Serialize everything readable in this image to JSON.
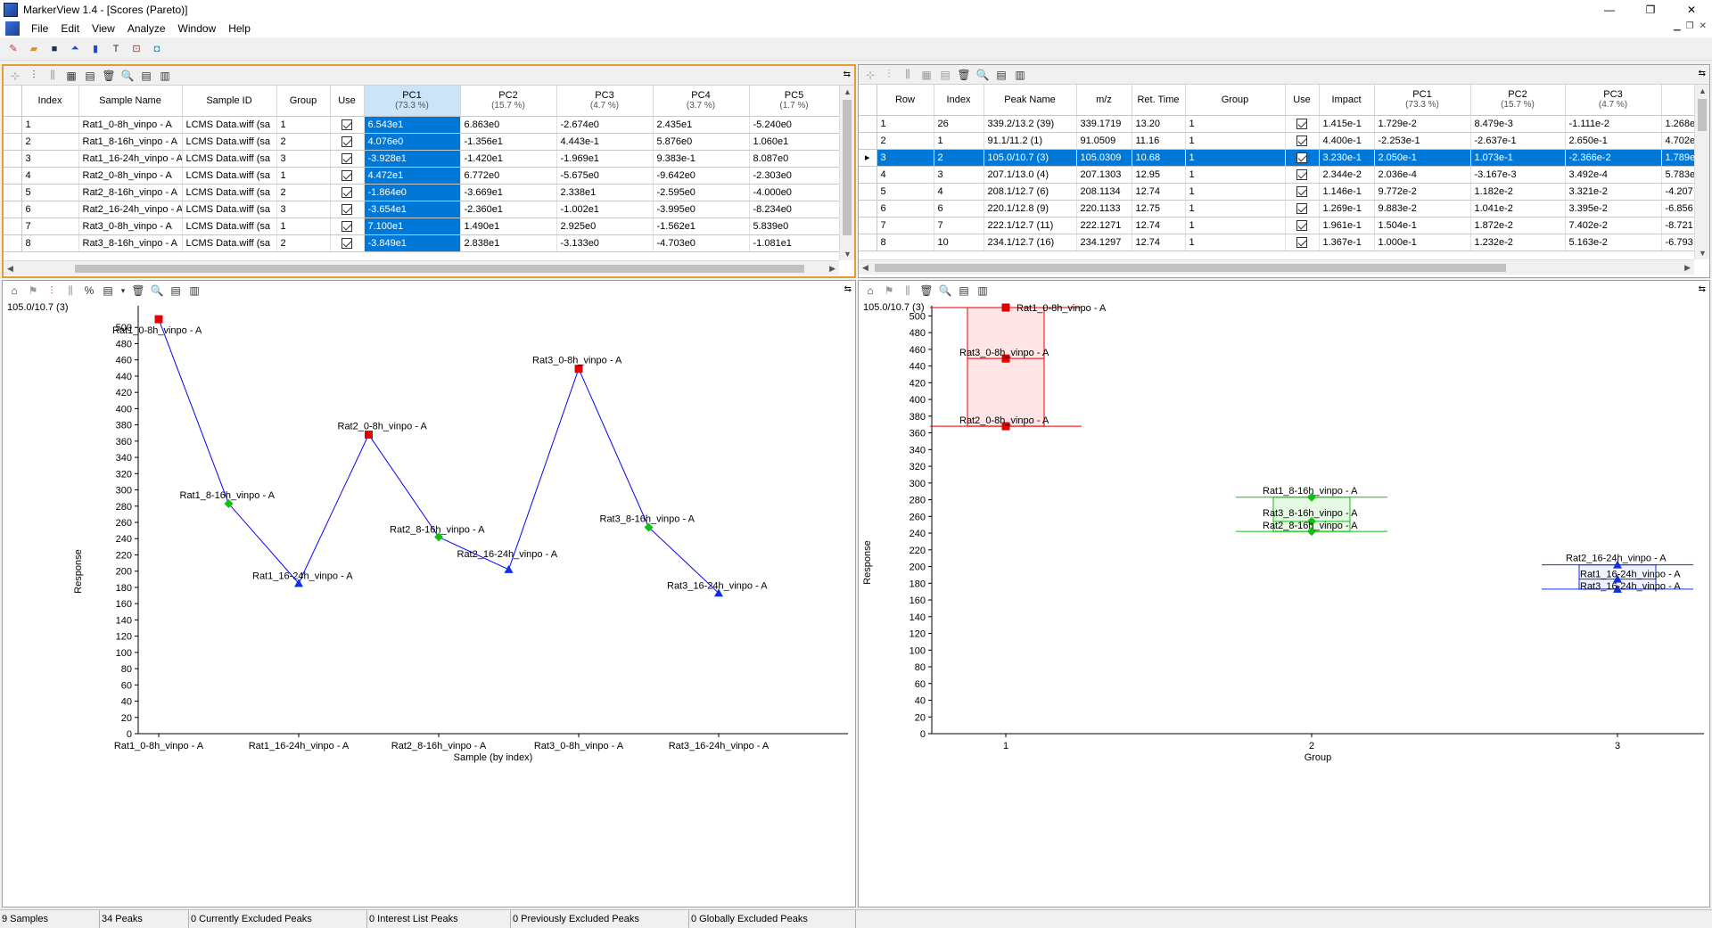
{
  "window": {
    "title": "MarkerView 1.4 - [Scores (Pareto)]",
    "minimize": "—",
    "maximize": "❐",
    "close": "✕"
  },
  "menu": [
    "File",
    "Edit",
    "View",
    "Analyze",
    "Window",
    "Help"
  ],
  "scores_table": {
    "headers": [
      {
        "label": "Index",
        "sub": ""
      },
      {
        "label": "Sample Name",
        "sub": ""
      },
      {
        "label": "Sample ID",
        "sub": ""
      },
      {
        "label": "Group",
        "sub": ""
      },
      {
        "label": "Use",
        "sub": ""
      },
      {
        "label": "PC1",
        "sub": "(73.3 %)"
      },
      {
        "label": "PC2",
        "sub": "(15.7 %)"
      },
      {
        "label": "PC3",
        "sub": "(4.7 %)"
      },
      {
        "label": "PC4",
        "sub": "(3.7 %)"
      },
      {
        "label": "PC5",
        "sub": "(1.7 %)"
      }
    ],
    "rows": [
      [
        "1",
        "Rat1_0-8h_vinpo - A",
        "LCMS Data.wiff (sa",
        "1",
        "6.543e1",
        "6.863e0",
        "-2.674e0",
        "2.435e1",
        "-5.240e0"
      ],
      [
        "2",
        "Rat1_8-16h_vinpo - A",
        "LCMS Data.wiff (sa",
        "2",
        "4.076e0",
        "-1.356e1",
        "4.443e-1",
        "5.876e0",
        "1.060e1"
      ],
      [
        "3",
        "Rat1_16-24h_vinpo - A",
        "LCMS Data.wiff (sa",
        "3",
        "-3.928e1",
        "-1.420e1",
        "-1.969e1",
        "9.383e-1",
        "8.087e0"
      ],
      [
        "4",
        "Rat2_0-8h_vinpo - A",
        "LCMS Data.wiff (sa",
        "1",
        "4.472e1",
        "6.772e0",
        "-5.675e0",
        "-9.642e0",
        "-2.303e0"
      ],
      [
        "5",
        "Rat2_8-16h_vinpo - A",
        "LCMS Data.wiff (sa",
        "2",
        "-1.864e0",
        "-3.669e1",
        "2.338e1",
        "-2.595e0",
        "-4.000e0"
      ],
      [
        "6",
        "Rat2_16-24h_vinpo - A",
        "LCMS Data.wiff (sa",
        "3",
        "-3.654e1",
        "-2.360e1",
        "-1.002e1",
        "-3.995e0",
        "-8.234e0"
      ],
      [
        "7",
        "Rat3_0-8h_vinpo - A",
        "LCMS Data.wiff (sa",
        "1",
        "7.100e1",
        "1.490e1",
        "2.925e0",
        "-1.562e1",
        "5.839e0"
      ],
      [
        "8",
        "Rat3_8-16h_vinpo - A",
        "LCMS Data.wiff (sa",
        "2",
        "-3.849e1",
        "2.838e1",
        "-3.133e0",
        "-4.703e0",
        "-1.081e1"
      ]
    ]
  },
  "peaks_table": {
    "headers": [
      {
        "label": "Row",
        "sub": ""
      },
      {
        "label": "Index",
        "sub": ""
      },
      {
        "label": "Peak Name",
        "sub": ""
      },
      {
        "label": "m/z",
        "sub": ""
      },
      {
        "label": "Ret. Time",
        "sub": ""
      },
      {
        "label": "Group",
        "sub": ""
      },
      {
        "label": "Use",
        "sub": ""
      },
      {
        "label": "Impact",
        "sub": ""
      },
      {
        "label": "PC1",
        "sub": "(73.3 %)"
      },
      {
        "label": "PC2",
        "sub": "(15.7 %)"
      },
      {
        "label": "PC3",
        "sub": "(4.7 %)"
      },
      {
        "label": "",
        "sub": ""
      }
    ],
    "rows": [
      [
        "1",
        "26",
        "339.2/13.2 (39)",
        "339.1719",
        "13.20",
        "1",
        "1.415e-1",
        "1.729e-2",
        "8.479e-3",
        "-1.111e-2",
        "1.268e"
      ],
      [
        "2",
        "1",
        "91.1/11.2 (1)",
        "91.0509",
        "11.16",
        "1",
        "4.400e-1",
        "-2.253e-1",
        "-2.637e-1",
        "2.650e-1",
        "4.702e"
      ],
      [
        "3",
        "2",
        "105.0/10.7 (3)",
        "105.0309",
        "10.68",
        "1",
        "3.230e-1",
        "2.050e-1",
        "1.073e-1",
        "-2.366e-2",
        "1.789e"
      ],
      [
        "4",
        "3",
        "207.1/13.0 (4)",
        "207.1303",
        "12.95",
        "1",
        "2.344e-2",
        "2.036e-4",
        "-3.167e-3",
        "3.492e-4",
        "5.783e"
      ],
      [
        "5",
        "4",
        "208.1/12.7 (6)",
        "208.1134",
        "12.74",
        "1",
        "1.146e-1",
        "9.772e-2",
        "1.182e-2",
        "3.321e-2",
        "-4.207"
      ],
      [
        "6",
        "6",
        "220.1/12.8 (9)",
        "220.1133",
        "12.75",
        "1",
        "1.269e-1",
        "9.883e-2",
        "1.041e-2",
        "3.395e-2",
        "-6.856"
      ],
      [
        "7",
        "7",
        "222.1/12.7 (11)",
        "222.1271",
        "12.74",
        "1",
        "1.961e-1",
        "1.504e-1",
        "1.872e-2",
        "7.402e-2",
        "-8.721"
      ],
      [
        "8",
        "10",
        "234.1/12.7 (16)",
        "234.1297",
        "12.74",
        "1",
        "1.367e-1",
        "1.000e-1",
        "1.232e-2",
        "5.163e-2",
        "-6.793"
      ]
    ],
    "selected_row": 2
  },
  "left_plot": {
    "peak_id": "105.0/10.7 (3)",
    "ylabel": "Response",
    "xlabel": "Sample (by index)",
    "pct_label": "%"
  },
  "right_plot": {
    "peak_id": "105.0/10.7 (3)",
    "ylabel": "Response",
    "xlabel": "Group"
  },
  "chart_data": [
    {
      "type": "line",
      "title": "",
      "xlabel": "Sample (by index)",
      "ylabel": "Response",
      "ylim": [
        0,
        520
      ],
      "yticks": [
        0,
        20,
        40,
        60,
        80,
        100,
        120,
        140,
        160,
        180,
        200,
        220,
        240,
        260,
        280,
        300,
        320,
        340,
        360,
        380,
        400,
        420,
        440,
        460,
        480,
        500
      ],
      "x_tick_labels": [
        "Rat1_0-8h_vinpo - A",
        "Rat1_16-24h_vinpo - A",
        "Rat2_8-16h_vinpo - A",
        "Rat3_0-8h_vinpo - A",
        "Rat3_16-24h_vinpo - A"
      ],
      "x_tick_index": [
        1,
        3,
        5,
        7,
        9
      ],
      "points": [
        {
          "index": 1,
          "label": "Rat1_0-8h_vinpo - A",
          "value": 510,
          "group": 1
        },
        {
          "index": 2,
          "label": "Rat1_8-16h_vinpo - A",
          "value": 283,
          "group": 2
        },
        {
          "index": 3,
          "label": "Rat1_16-24h_vinpo - A",
          "value": 185,
          "group": 3
        },
        {
          "index": 4,
          "label": "Rat2_0-8h_vinpo - A",
          "value": 368,
          "group": 1
        },
        {
          "index": 5,
          "label": "Rat2_8-16h_vinpo - A",
          "value": 242,
          "group": 2
        },
        {
          "index": 6,
          "label": "Rat2_16-24h_vinpo - A",
          "value": 202,
          "group": 3
        },
        {
          "index": 7,
          "label": "Rat3_0-8h_vinpo - A",
          "value": 449,
          "group": 1
        },
        {
          "index": 8,
          "label": "Rat3_8-16h_vinpo - A",
          "value": 254,
          "group": 2
        },
        {
          "index": 9,
          "label": "Rat3_16-24h_vinpo - A",
          "value": 173,
          "group": 3
        }
      ]
    },
    {
      "type": "scatter",
      "title": "",
      "xlabel": "Group",
      "ylabel": "Response",
      "ylim": [
        0,
        510
      ],
      "yticks": [
        0,
        20,
        40,
        60,
        80,
        100,
        120,
        140,
        160,
        180,
        200,
        220,
        240,
        260,
        280,
        300,
        320,
        340,
        360,
        380,
        400,
        420,
        440,
        460,
        480,
        500
      ],
      "xticks": [
        "1",
        "2",
        "3"
      ],
      "points": [
        {
          "group": 1,
          "label": "Rat1_0-8h_vinpo - A",
          "value": 510
        },
        {
          "group": 1,
          "label": "Rat3_0-8h_vinpo - A",
          "value": 449
        },
        {
          "group": 1,
          "label": "Rat2_0-8h_vinpo - A",
          "value": 368
        },
        {
          "group": 2,
          "label": "Rat1_8-16h_vinpo - A",
          "value": 283
        },
        {
          "group": 2,
          "label": "Rat3_8-16h_vinpo - A",
          "value": 254
        },
        {
          "group": 2,
          "label": "Rat2_8-16h_vinpo - A",
          "value": 242
        },
        {
          "group": 3,
          "label": "Rat2_16-24h_vinpo - A",
          "value": 202
        },
        {
          "group": 3,
          "label": "Rat1_16-24h_vinpo - A",
          "value": 185
        },
        {
          "group": 3,
          "label": "Rat3_16-24h_vinpo - A",
          "value": 173
        }
      ]
    }
  ],
  "colors": {
    "group1": "#e00000",
    "group2": "#10c010",
    "group3": "#1030e0",
    "line": "#0000ff",
    "selection": "#0078d7",
    "active_border": "#e0a030"
  },
  "status": [
    "9 Samples",
    "34 Peaks",
    "0 Currently Excluded Peaks",
    "0 Interest List Peaks",
    "0 Previously Excluded Peaks",
    "0 Globally Excluded Peaks"
  ]
}
